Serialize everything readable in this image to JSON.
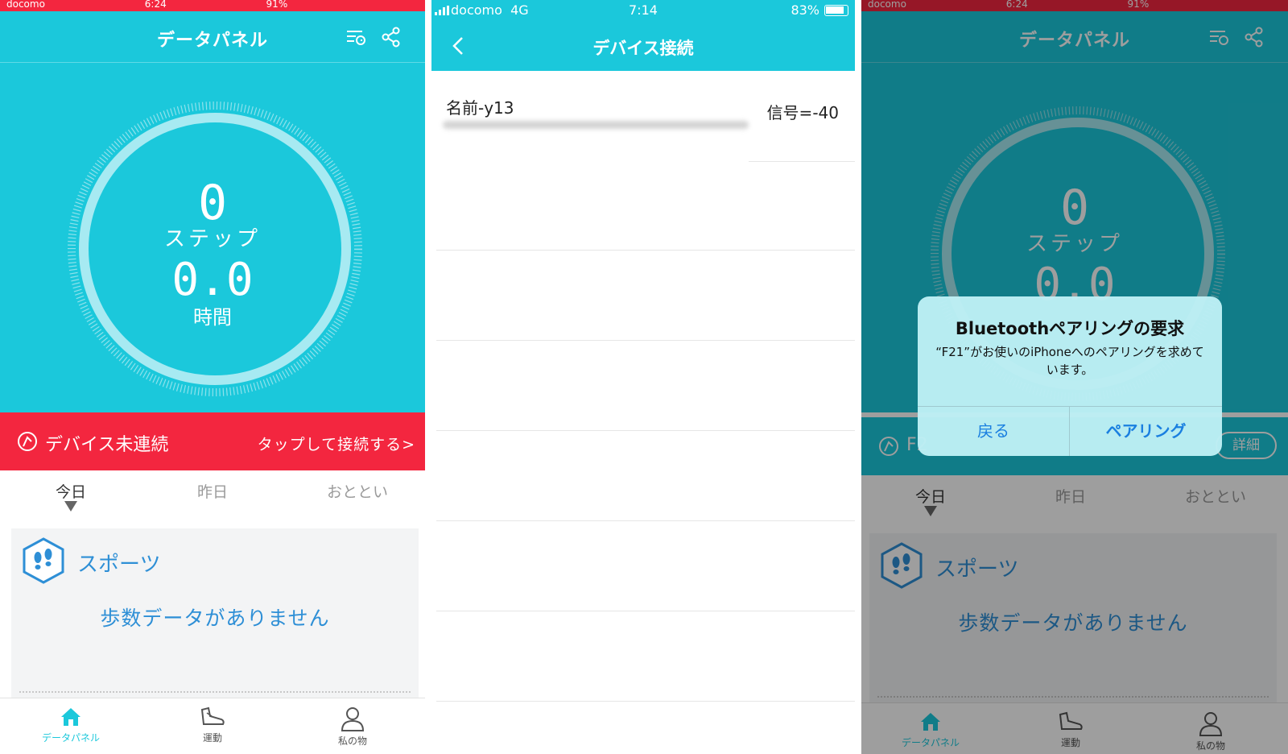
{
  "screen1": {
    "status_left": "docomo",
    "status_time": "6:24",
    "status_right": "91%",
    "header_title": "データパネル",
    "steps_value": "0",
    "steps_label": "ステップ",
    "hours_value": "0.0",
    "hours_label": "時間",
    "banner_status": "デバイス未連続",
    "banner_action": "タップして接続する>",
    "days": [
      "今日",
      "昨日",
      "おととい"
    ],
    "card_title": "スポーツ",
    "card_empty": "歩数データがありません",
    "nav": [
      "データパネル",
      "運動",
      "私の物"
    ]
  },
  "screen2": {
    "carrier": "docomo",
    "network": "4G",
    "time": "7:14",
    "battery": "83%",
    "header_title": "デバイス接続",
    "device_name": "名前-y13",
    "device_signal": "信号=-40"
  },
  "screen3": {
    "status_left": "docomo",
    "status_time": "6:24",
    "status_right": "91%",
    "header_title": "データパネル",
    "steps_value": "0",
    "steps_label": "ステップ",
    "hours_value": "0.0",
    "device_partial": "F2",
    "detail_label": "詳細",
    "days": [
      "今日",
      "昨日",
      "おととい"
    ],
    "card_title": "スポーツ",
    "card_empty": "歩数データがありません",
    "nav": [
      "データパネル",
      "運動",
      "私の物"
    ],
    "alert": {
      "title": "Bluetoothペアリングの要求",
      "message": "“F21”がお使いのiPhoneへのペアリングを求めています。",
      "cancel": "戻る",
      "confirm": "ペアリング"
    }
  },
  "colors": {
    "teal": "#1bc8db",
    "red": "#f3263f",
    "blue_text": "#2e8fd6",
    "alert_button": "#1a7fe0"
  },
  "icons": [
    "filter-list-icon",
    "share-icon",
    "watch-icon",
    "back-chevron-icon",
    "footprints-icon",
    "home-icon",
    "shoe-icon",
    "person-icon"
  ]
}
